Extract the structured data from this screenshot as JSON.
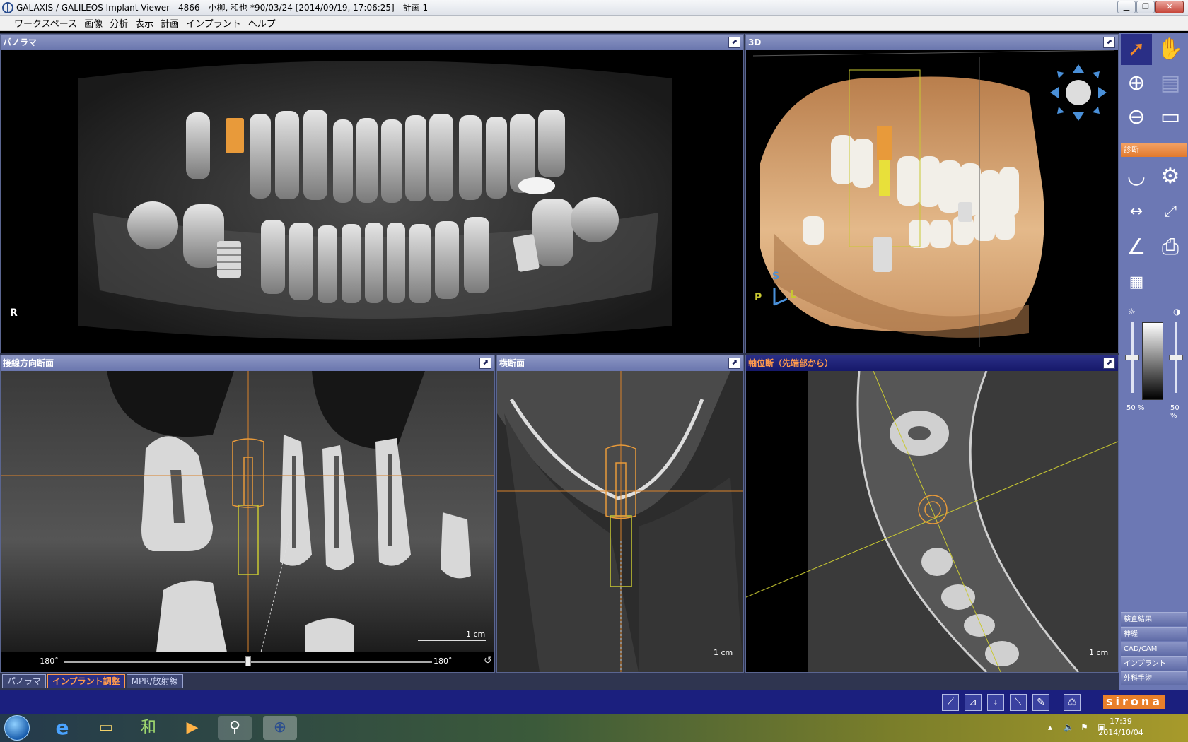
{
  "window": {
    "title": "GALAXIS / GALILEOS Implant Viewer - 4866 - 小柳, 和也 *90/03/24 [2014/09/19, 17:06:25] - 計画 1",
    "minimize": "▁",
    "restore": "❐",
    "close": "✕"
  },
  "menu": [
    "ワークスペース",
    "画像",
    "分析",
    "表示",
    "計画",
    "インプラント",
    "ヘルプ"
  ],
  "panels": {
    "panorama": {
      "title": "パノラマ",
      "marker": "R"
    },
    "view3d": {
      "title": "3D",
      "axis_s": "S",
      "axis_p": "P",
      "axis_l": "L"
    },
    "tangential": {
      "title": "接線方向断面",
      "scale": "1 cm",
      "slider_min": "−180˚",
      "slider_max": "180˚",
      "slider_value": 0.5
    },
    "cross": {
      "title": "横断面",
      "scale": "1 cm"
    },
    "axial": {
      "title": "軸位断（先端部から）",
      "scale": "1 cm"
    }
  },
  "tools": {
    "section_label": "診断",
    "brightness_label": "50 %",
    "contrast_label": "50 %",
    "brightness": 0.5,
    "contrast": 0.5,
    "side_items": [
      "検査結果",
      "神経",
      "CAD/CAM",
      "インプラント",
      "外科手術"
    ]
  },
  "bottom_tabs": [
    "パノラマ",
    "インプラント調整",
    "MPR/放射線"
  ],
  "brand": "sirona",
  "taskbar": {
    "time": "17:39",
    "date": "2014/10/04"
  },
  "colors": {
    "implant_orange": "#e89a3a",
    "crosshair_orange": "#d9822b",
    "axial_yellow": "#c8c832",
    "panel_header": "#6a76ae",
    "active_header": "#16196a",
    "status_bar": "#1b1f7e"
  }
}
